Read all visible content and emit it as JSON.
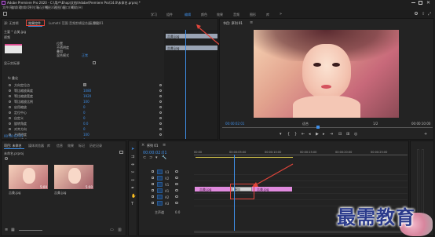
{
  "titlebar": {
    "title": "Adobe Premiere Pro 2020 - C:\\用户\\Ehop\\文档\\Adobe\\Premiere Pro\\14.0\\未命名.prproj *"
  },
  "menubar": {
    "items": [
      "文件(F)",
      "编辑(E)",
      "剪辑(C)",
      "序列(S)",
      "标记(M)",
      "图形(G)",
      "视图(V)",
      "窗口(W)",
      "帮助(H)"
    ]
  },
  "workspaces": {
    "items": [
      "学习",
      "组件",
      "编辑",
      "颜色",
      "效果",
      "音频",
      "图形",
      "库"
    ],
    "active_index": 2
  },
  "effect_controls": {
    "tabs": [
      "源: 无剪辑",
      "效果控件",
      "Lumetri 范围",
      "源: (无剪辑)",
      "音频剪辑混合器: 序列01",
      "元数据"
    ],
    "active_tab_index": 1,
    "source_label": "主要 * 吉美.jpg",
    "fx_row": "视频",
    "property_rows": [
      {
        "label": "位置",
        "value": ""
      },
      {
        "label": "不透明度",
        "value": "100"
      },
      {
        "label": "叠加",
        "value": ""
      },
      {
        "label": "混合模式",
        "value": "正常"
      }
    ],
    "transition_label": "白场过渡",
    "transition_name": "叠加",
    "section_title": "显示实际源",
    "transform_header": "fx 叠化",
    "transform_rows": [
      {
        "label": "方向定位点",
        "value": "",
        "checkbox": true
      },
      {
        "label": "等比缩放高度",
        "value": "1080"
      },
      {
        "label": "等比缩放宽度",
        "value": "1920"
      },
      {
        "label": "等比缩放比例",
        "value": "100"
      },
      {
        "label": "启用缩放",
        "value": "0"
      },
      {
        "label": "定位中心",
        "value": "0"
      },
      {
        "label": "自定义",
        "value": "0"
      },
      {
        "label": "旋转角度",
        "value": "0.0"
      },
      {
        "label": "对齐方向",
        "value": "0"
      },
      {
        "label": "不透明度",
        "value": "100"
      },
      {
        "label": "混合模式",
        "value": "0"
      }
    ],
    "mini_timeline_clips": [
      "吉美.jpg",
      "吉美.jpg"
    ],
    "timecode": "00:00:02:01"
  },
  "program_monitor": {
    "title": "节目: 序列 01",
    "timecode_left": "00:00:02:01",
    "zoom": "适合",
    "fraction": "1/2",
    "timecode_right": "00:00:10:00"
  },
  "project_panel": {
    "tabs": [
      "项目: 未命名",
      "媒体浏览器",
      "库",
      "信息",
      "效果",
      "标记",
      "历史记录"
    ],
    "active_tab_index": 0,
    "path": "未命名.prproj",
    "items": [
      {
        "name": "吉美.jpg",
        "duration": "5:00"
      },
      {
        "name": "吉美.jpg",
        "duration": "5:00"
      }
    ]
  },
  "timeline": {
    "title": "序列 01",
    "timecode": "00:00:02:01",
    "ruler_labels": [
      "00:00",
      "00:00:05:00",
      "00:00:10:00",
      "00:00:15:00",
      "00:00:20:00",
      "00:00:25:00",
      "00:00:30:00"
    ],
    "tracks": [
      {
        "name": "V3"
      },
      {
        "name": "V2"
      },
      {
        "name": "V1"
      },
      {
        "name": "A1"
      },
      {
        "name": "A2"
      },
      {
        "name": "A3"
      }
    ],
    "clip_left": "吉美.jpg",
    "transition": "叠加",
    "clip_right": "吉美.jpg",
    "master_label": "主声道",
    "master_value": "0.0"
  },
  "watermark": {
    "text": "最需教育"
  },
  "colors": {
    "accent": "#3f8fe8",
    "annotation": "#e0453b",
    "clip": "#e08ade"
  }
}
